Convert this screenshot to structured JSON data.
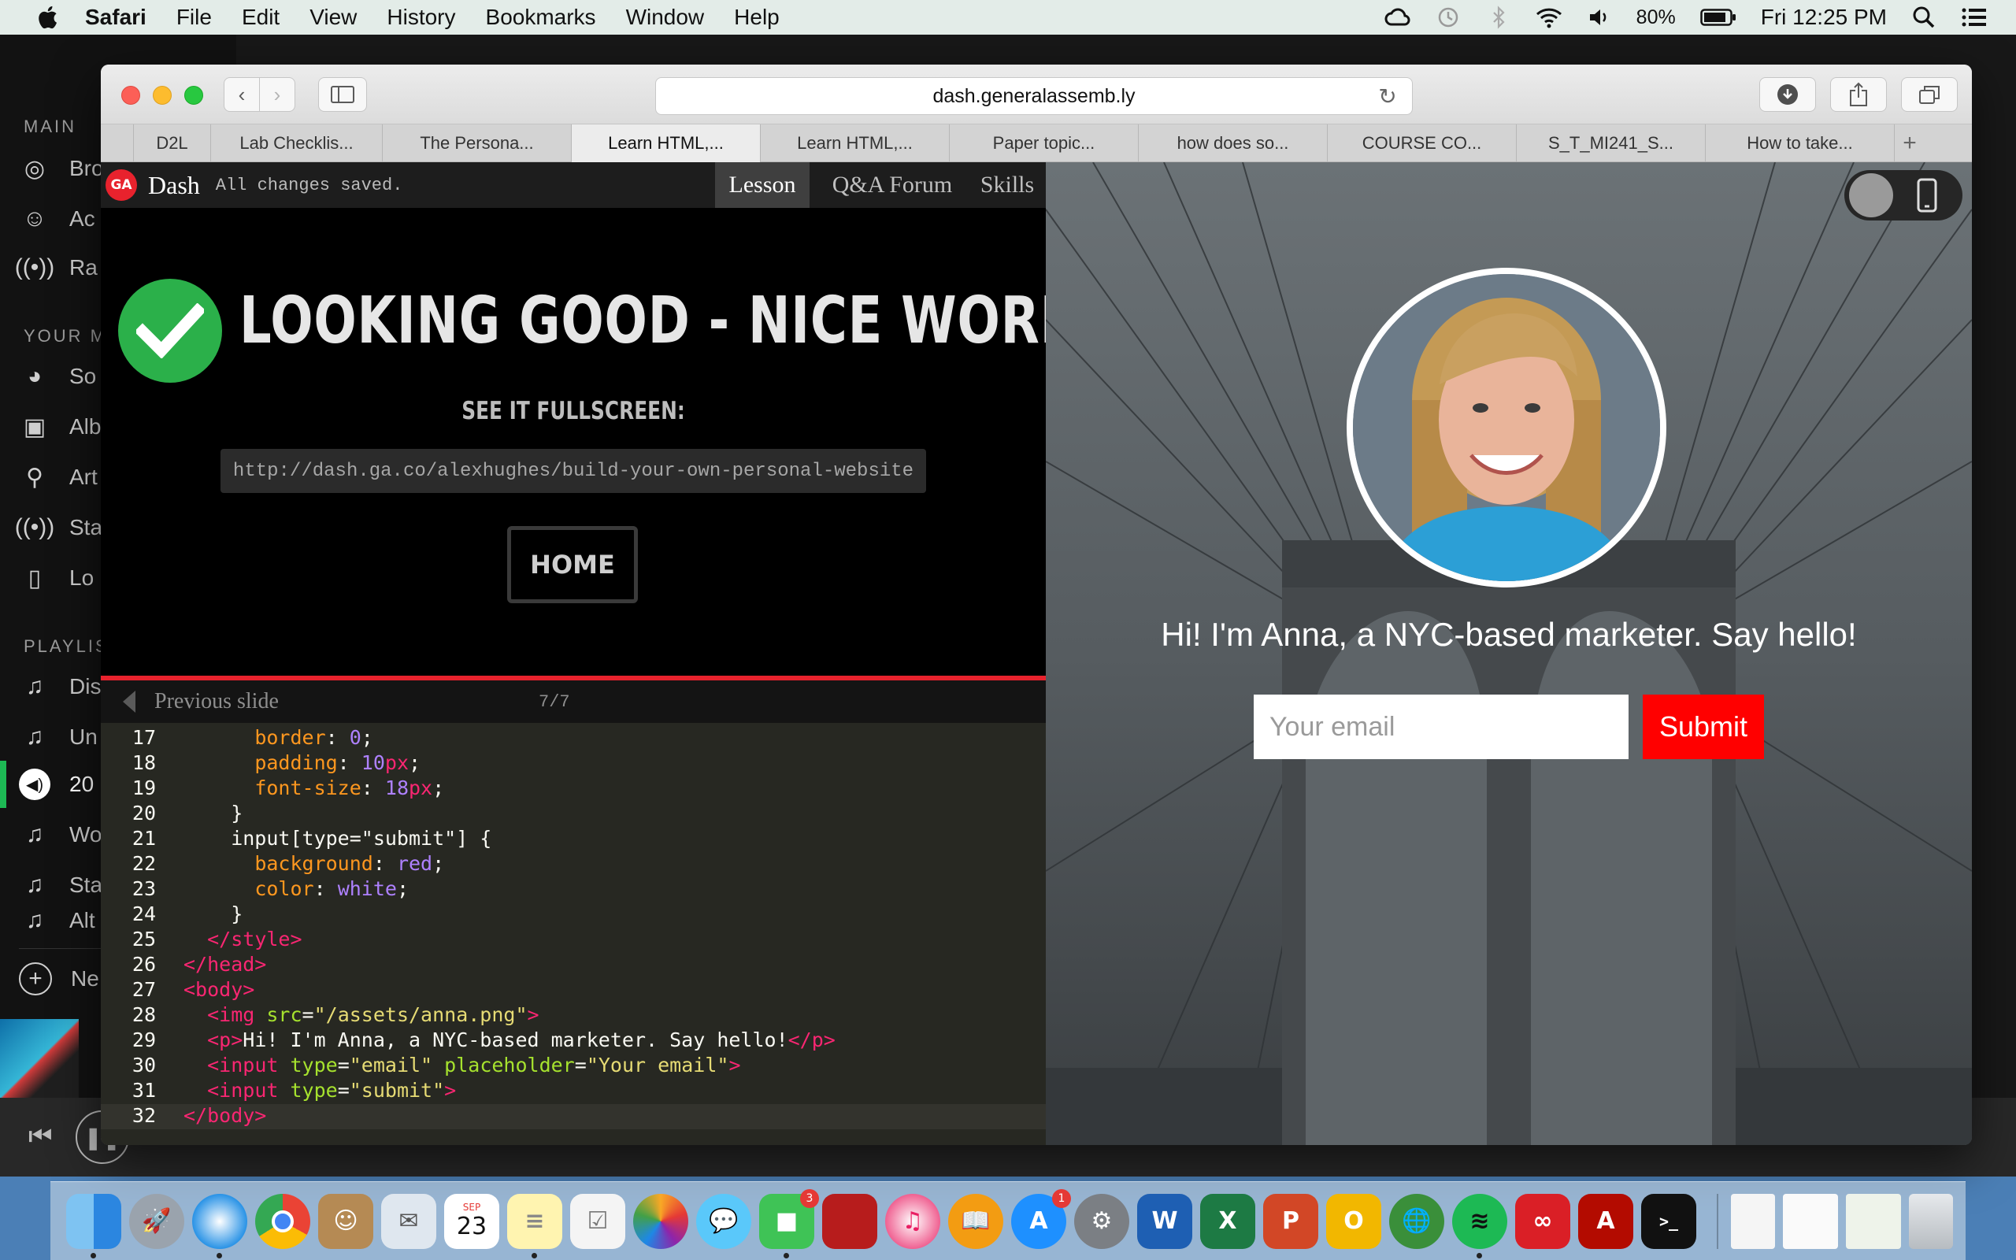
{
  "menubar": {
    "app_name": "Safari",
    "menus": [
      "File",
      "Edit",
      "View",
      "History",
      "Bookmarks",
      "Window",
      "Help"
    ],
    "battery": "80%",
    "clock": "Fri 12:25 PM"
  },
  "spotify": {
    "sidebar": {
      "main_heading": "MAIN",
      "main_items": [
        "Bro",
        "Ac",
        "Ra"
      ],
      "your_music_heading": "YOUR M",
      "your_music_items": [
        "So",
        "Alb",
        "Art",
        "Sta",
        "Lo"
      ],
      "playlists_heading": "PLAYLIS",
      "playlist_items": [
        "Dis",
        "Un",
        "20",
        "Wo",
        "Sta",
        "Alt"
      ],
      "new_playlist_label": "Ne"
    }
  },
  "safari": {
    "url": "dash.generalassemb.ly",
    "tabs": [
      {
        "label": "D2L",
        "active": false
      },
      {
        "label": "Lab Checklis...",
        "active": false
      },
      {
        "label": "The Persona...",
        "active": false
      },
      {
        "label": "Learn HTML,...",
        "active": true
      },
      {
        "label": "Learn HTML,...",
        "active": false
      },
      {
        "label": "Paper topic...",
        "active": false
      },
      {
        "label": "how does so...",
        "active": false
      },
      {
        "label": "COURSE CO...",
        "active": false
      },
      {
        "label": "S_T_MI241_S...",
        "active": false
      },
      {
        "label": "How to take...",
        "active": false
      }
    ]
  },
  "dash": {
    "logo_text": "GA",
    "brand": "Dash",
    "save_status": "All changes saved.",
    "nav": {
      "lesson": "Lesson",
      "forum": "Q&A Forum",
      "skills": "Skills"
    },
    "headline": "LOOKING GOOD - NICE WORK!",
    "fullscreen_label": "SEE IT FULLSCREEN:",
    "share_url": "http://dash.ga.co/alexhughes/build-your-own-personal-website",
    "home_button": "HOME",
    "previous_slide": "Previous slide",
    "slide_counter": "7/7"
  },
  "editor": {
    "lines": [
      {
        "n": "17",
        "c": [
          [
            "      ",
            ""
          ],
          [
            "border",
            "pr"
          ],
          [
            ": ",
            ""
          ],
          [
            "0",
            "nm"
          ],
          [
            ";",
            ""
          ]
        ]
      },
      {
        "n": "18",
        "c": [
          [
            "      ",
            ""
          ],
          [
            "padding",
            "pr"
          ],
          [
            ": ",
            ""
          ],
          [
            "10",
            "nm"
          ],
          [
            "px",
            "kw"
          ],
          [
            ";",
            ""
          ]
        ]
      },
      {
        "n": "19",
        "c": [
          [
            "      ",
            ""
          ],
          [
            "font-size",
            "pr"
          ],
          [
            ": ",
            ""
          ],
          [
            "18",
            "nm"
          ],
          [
            "px",
            "kw"
          ],
          [
            ";",
            ""
          ]
        ]
      },
      {
        "n": "20",
        "c": [
          [
            "    }",
            ""
          ]
        ]
      },
      {
        "n": "21",
        "c": [
          [
            "    input[type=\"submit\"] {",
            ""
          ]
        ]
      },
      {
        "n": "22",
        "c": [
          [
            "      ",
            ""
          ],
          [
            "background",
            "pr"
          ],
          [
            ": ",
            ""
          ],
          [
            "red",
            "nm"
          ],
          [
            ";",
            ""
          ]
        ]
      },
      {
        "n": "23",
        "c": [
          [
            "      ",
            ""
          ],
          [
            "color",
            "pr"
          ],
          [
            ": ",
            ""
          ],
          [
            "white",
            "nm"
          ],
          [
            ";",
            ""
          ]
        ]
      },
      {
        "n": "24",
        "c": [
          [
            "    }",
            ""
          ]
        ]
      },
      {
        "n": "25",
        "c": [
          [
            "  ",
            ""
          ],
          [
            "</style>",
            "tg"
          ]
        ]
      },
      {
        "n": "26",
        "c": [
          [
            "</head>",
            "tg"
          ]
        ]
      },
      {
        "n": "27",
        "c": [
          [
            "<body>",
            "tg"
          ]
        ]
      },
      {
        "n": "28",
        "c": [
          [
            "  ",
            ""
          ],
          [
            "<img ",
            "tg"
          ],
          [
            "src",
            "at"
          ],
          [
            "=",
            ""
          ],
          [
            "\"/assets/anna.png\"",
            "st"
          ],
          [
            ">",
            "tg"
          ]
        ]
      },
      {
        "n": "29",
        "c": [
          [
            "  ",
            ""
          ],
          [
            "<p>",
            "tg"
          ],
          [
            "Hi! I'm Anna, a NYC-based marketer. Say hello!",
            ""
          ],
          [
            "</p>",
            "tg"
          ]
        ]
      },
      {
        "n": "30",
        "c": [
          [
            "  ",
            ""
          ],
          [
            "<input ",
            "tg"
          ],
          [
            "type",
            "at"
          ],
          [
            "=",
            ""
          ],
          [
            "\"email\"",
            "st"
          ],
          [
            " ",
            ""
          ],
          [
            "placeholder",
            "at"
          ],
          [
            "=",
            ""
          ],
          [
            "\"Your email\"",
            "st"
          ],
          [
            ">",
            "tg"
          ]
        ]
      },
      {
        "n": "31",
        "c": [
          [
            "  ",
            ""
          ],
          [
            "<input ",
            "tg"
          ],
          [
            "type",
            "at"
          ],
          [
            "=",
            ""
          ],
          [
            "\"submit\"",
            "st"
          ],
          [
            ">",
            "tg"
          ]
        ]
      },
      {
        "n": "32",
        "c": [
          [
            "</body>",
            "tg"
          ]
        ]
      }
    ]
  },
  "preview": {
    "intro": "Hi! I'm Anna, a NYC-based marketer. Say hello!",
    "email_placeholder": "Your email",
    "submit_label": "Submit"
  },
  "dock": {
    "calendar_month": "SEP",
    "calendar_day": "23",
    "facetime_badge": "3",
    "appstore_badge": "1",
    "apps": [
      "finder-icon",
      "launchpad-icon",
      "safari-icon",
      "chrome-icon",
      "contacts-icon",
      "mail-icon",
      "calendar-icon",
      "notes-icon",
      "reminders-icon",
      "photos-icon",
      "messages-icon",
      "facetime-icon",
      "photo-booth-icon",
      "itunes-icon",
      "ibooks-icon",
      "app-store-icon",
      "system-preferences-icon",
      "word-icon",
      "excel-icon",
      "powerpoint-icon",
      "outlook-icon",
      "network-icon",
      "spotify-icon",
      "creative-cloud-icon",
      "acrobat-icon",
      "terminal-icon",
      "document-icon",
      "document-icon-2",
      "document-icon-3",
      "trash-icon"
    ]
  },
  "colors": {
    "ga_red": "#e8222d",
    "check_green": "#2bb04a",
    "submit_red": "#ff0000",
    "editor_bg": "#272822"
  }
}
